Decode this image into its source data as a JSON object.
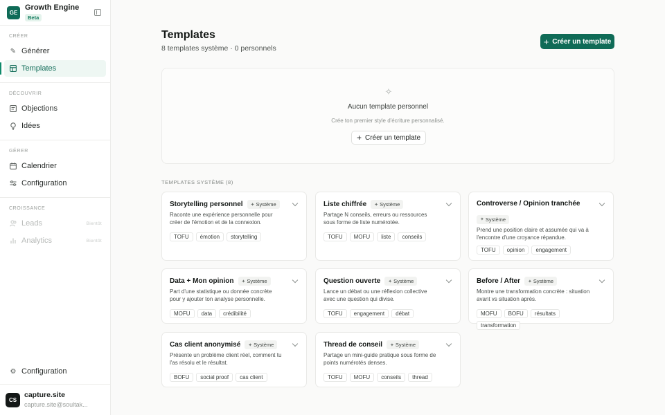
{
  "brand": {
    "logo": "GE",
    "name": "Growth Engine",
    "badge": "Beta"
  },
  "sidebar": {
    "sections": [
      {
        "label": "CRÉER",
        "items": [
          {
            "label": "Générer",
            "icon": "pencil-icon",
            "active": false
          },
          {
            "label": "Templates",
            "icon": "layout-icon",
            "active": true
          }
        ]
      },
      {
        "label": "DÉCOUVRIR",
        "items": [
          {
            "label": "Objections",
            "icon": "message-square-icon",
            "active": false
          },
          {
            "label": "Idées",
            "icon": "lightbulb-icon",
            "active": false
          }
        ]
      },
      {
        "label": "GÉRER",
        "items": [
          {
            "label": "Calendrier",
            "icon": "calendar-icon",
            "active": false
          },
          {
            "label": "Configuration",
            "icon": "sliders-icon",
            "active": false
          }
        ]
      },
      {
        "label": "CROISSANCE",
        "items": [
          {
            "label": "Leads",
            "icon": "users-icon",
            "soon": "Bientôt"
          },
          {
            "label": "Analytics",
            "icon": "bar-chart-icon",
            "soon": "Bientôt"
          }
        ]
      }
    ],
    "bottom_item": {
      "label": "Configuration",
      "icon": "gear-icon"
    },
    "user": {
      "initials": "CS",
      "name": "capture.site",
      "email": "capture.site@soultak..."
    }
  },
  "main": {
    "title": "Templates",
    "subtitle": "8 templates système · 0 personnels",
    "create_button": "Créer un template",
    "empty": {
      "title": "Aucun template personnel",
      "description": "Crée ton premier style d'écriture personnalisé.",
      "button": "Créer un template"
    },
    "system_label": "TEMPLATES SYSTÈME (8)",
    "badge_label": "Système",
    "cards": [
      {
        "title": "Storytelling personnel",
        "description": "Raconte une expérience personnelle pour créer de l'émotion et de la connexion.",
        "tags": [
          "TOFU",
          "émotion",
          "storytelling"
        ]
      },
      {
        "title": "Liste chiffrée",
        "description": "Partage N conseils, erreurs ou ressources sous forme de liste numérotée.",
        "tags": [
          "TOFU",
          "MOFU",
          "liste",
          "conseils"
        ]
      },
      {
        "title": "Controverse / Opinion tranchée",
        "description": "Prend une position claire et assumée qui va à l'encontre d'une croyance répandue.",
        "tags": [
          "TOFU",
          "opinion",
          "engagement"
        ]
      },
      {
        "title": "Data + Mon opinion",
        "description": "Part d'une statistique ou donnée concrète pour y ajouter ton analyse personnelle.",
        "tags": [
          "MOFU",
          "data",
          "crédibilité"
        ]
      },
      {
        "title": "Question ouverte",
        "description": "Lance un débat ou une réflexion collective avec une question qui divise.",
        "tags": [
          "TOFU",
          "engagement",
          "débat"
        ]
      },
      {
        "title": "Before / After",
        "description": "Montre une transformation concrète : situation avant vs situation après.",
        "tags": [
          "MOFU",
          "BOFU",
          "résultats",
          "transformation"
        ]
      },
      {
        "title": "Cas client anonymisé",
        "description": "Présente un problème client réel, comment tu l'as résolu et le résultat.",
        "tags": [
          "BOFU",
          "social proof",
          "cas client"
        ]
      },
      {
        "title": "Thread de conseil",
        "description": "Partage un mini-guide pratique sous forme de points numérotés denses.",
        "tags": [
          "TOFU",
          "MOFU",
          "conseils",
          "thread"
        ]
      }
    ]
  },
  "colors": {
    "accent": "#0f6b57",
    "active_bg": "#eef7f3",
    "background": "#fafaf9"
  }
}
